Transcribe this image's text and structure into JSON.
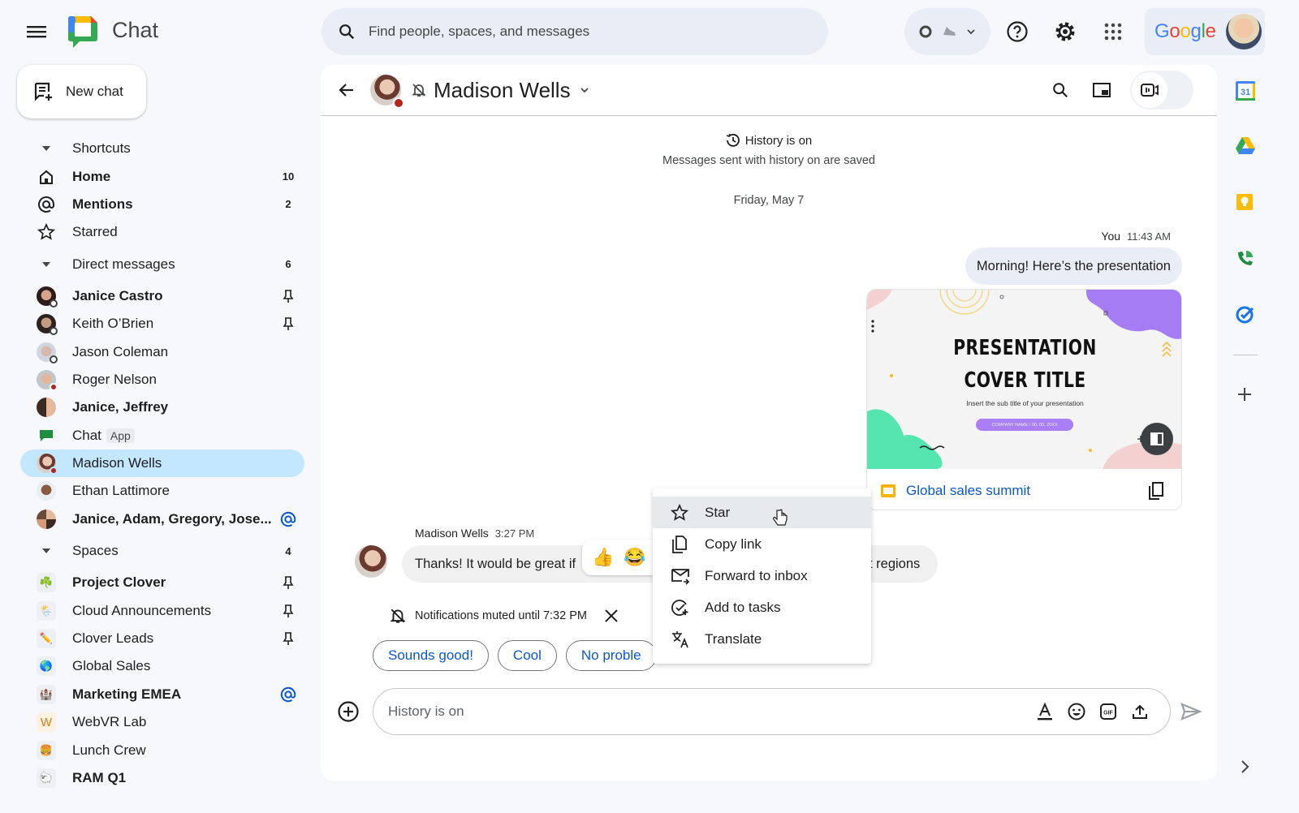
{
  "app": {
    "title": "Chat"
  },
  "new_chat": {
    "label": "New chat"
  },
  "search": {
    "placeholder": "Find people, spaces, and messages"
  },
  "account": {
    "brand": "Google"
  },
  "sidebar": {
    "shortcuts": {
      "label": "Shortcuts",
      "items": [
        {
          "label": "Home",
          "count": "10",
          "bold": true,
          "icon": "home-icon"
        },
        {
          "label": "Mentions",
          "count": "2",
          "bold": true,
          "icon": "at-icon"
        },
        {
          "label": "Starred",
          "count": "",
          "bold": false,
          "icon": "star-icon"
        }
      ]
    },
    "direct_messages": {
      "label": "Direct messages",
      "count": "6",
      "items": [
        {
          "label": "Janice Castro",
          "bold": true,
          "pinned": true
        },
        {
          "label": "Keith O’Brien",
          "bold": false,
          "pinned": true
        },
        {
          "label": "Jason Coleman",
          "bold": false
        },
        {
          "label": "Roger Nelson",
          "bold": false
        },
        {
          "label": "Janice, Jeffrey",
          "bold": true
        },
        {
          "label": "Chat",
          "badge": "App",
          "bold": false
        },
        {
          "label": "Madison Wells",
          "bold": false,
          "selected": true
        },
        {
          "label": "Ethan Lattimore",
          "bold": false
        },
        {
          "label": "Janice, Adam, Gregory, Jose...",
          "bold": true,
          "mention": true
        }
      ]
    },
    "spaces": {
      "label": "Spaces",
      "count": "4",
      "items": [
        {
          "label": "Project Clover",
          "bold": true,
          "pinned": true,
          "emoji": "☘️"
        },
        {
          "label": "Cloud Announcements",
          "bold": false,
          "pinned": true,
          "emoji": "🌦️"
        },
        {
          "label": "Clover Leads",
          "bold": false,
          "pinned": true,
          "emoji": "✏️"
        },
        {
          "label": "Global Sales",
          "bold": false,
          "emoji": "🌎"
        },
        {
          "label": "Marketing EMEA",
          "bold": true,
          "mention": true,
          "emoji": "🏰"
        },
        {
          "label": "WebVR Lab",
          "bold": false,
          "emoji": "W"
        },
        {
          "label": "Lunch Crew",
          "bold": false,
          "emoji": "🍔"
        },
        {
          "label": "RAM Q1",
          "bold": true,
          "emoji": "🐑"
        }
      ]
    }
  },
  "conversation": {
    "name": "Madison Wells",
    "history_title": "History is on",
    "history_sub": "Messages sent with history on are saved",
    "date": "Friday, May 7",
    "messages": [
      {
        "sender": "You",
        "time": "11:43 AM",
        "text": "Morning! Here’s the presentation",
        "attachment": {
          "name": "Global sales summit",
          "slide_title_1": "PRESENTATION",
          "slide_title_2": "COVER TITLE",
          "slide_subtitle": "Insert the sub title of your presentation",
          "slide_pill": "COMPANY NAME / 00. 00. 20XX"
        }
      },
      {
        "sender": "Madison Wells",
        "time": "3:27 PM",
        "text": "Thanks! It would be great if",
        "text_tail": "t regions"
      }
    ],
    "reactions": [
      "👍",
      "😂"
    ],
    "muted_notice": "Notifications muted until 7:32 PM",
    "smart_replies": [
      "Sounds good!",
      "Cool",
      "No proble"
    ],
    "composer_placeholder": "History is on"
  },
  "context_menu": {
    "items": [
      {
        "label": "Star",
        "icon": "star-icon",
        "hover": true
      },
      {
        "label": "Copy link",
        "icon": "copy-link-icon"
      },
      {
        "label": "Forward to inbox",
        "icon": "forward-to-inbox-icon"
      },
      {
        "label": "Add to tasks",
        "icon": "add-task-icon"
      },
      {
        "label": "Translate",
        "icon": "translate-icon"
      }
    ]
  },
  "rail": {
    "calendar_day": "31"
  },
  "colors": {
    "accent": "#0b57d0",
    "selected": "#c2e7ff",
    "dnd": "#b3261e"
  }
}
